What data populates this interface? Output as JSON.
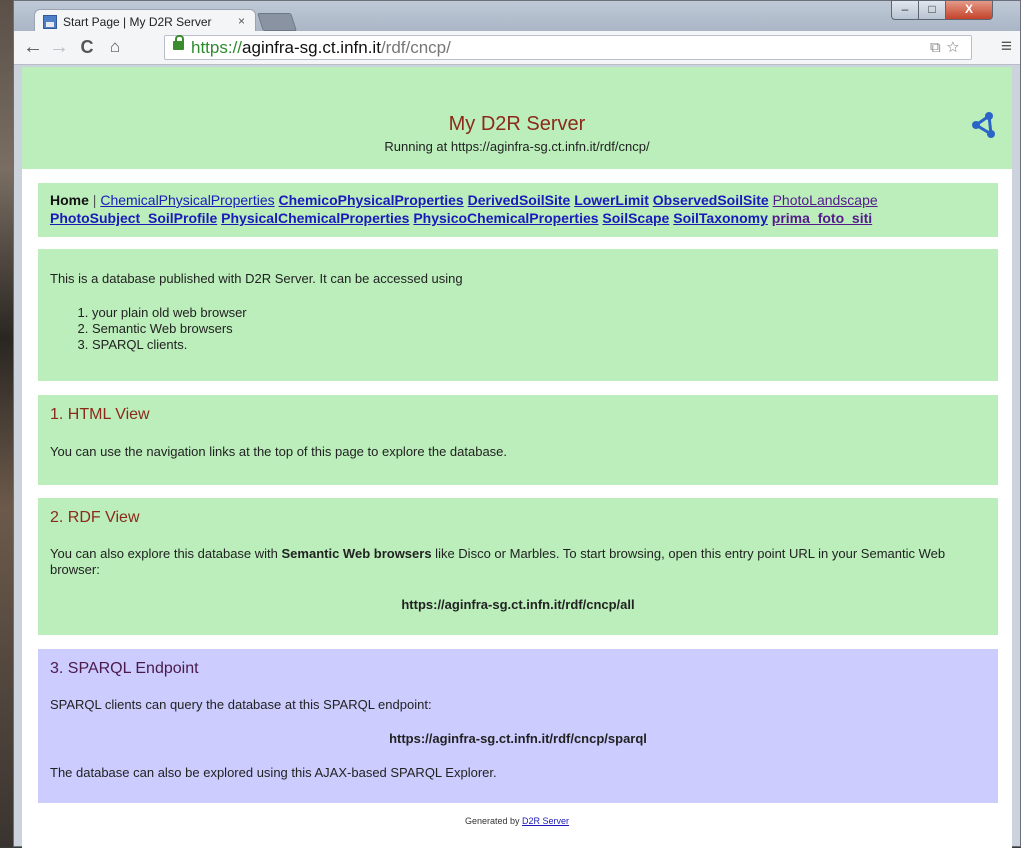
{
  "browser": {
    "tab_title": "Start Page | My D2R Server",
    "tab_close": "×",
    "url_scheme": "https://",
    "url_host": "aginfra-sg.ct.infn.it",
    "url_path": "/rdf/cncp/",
    "nav_back": "←",
    "nav_forward": "→",
    "nav_reload": "C",
    "nav_home": "⌂",
    "menu": "≡",
    "omni_icons": "⧉☆",
    "win_min": "–",
    "win_max": "□",
    "win_close": "X"
  },
  "header": {
    "title": "My D2R Server",
    "subtitle": "Running at https://aginfra-sg.ct.infn.it/rdf/cncp/",
    "share_icon": "share-icon"
  },
  "nav": {
    "home": "Home",
    "separator": "|",
    "links": [
      "ChemicalPhysicalProperties",
      "ChemicoPhysicalProperties",
      "DerivedSoilSite",
      "LowerLimit",
      "ObservedSoilSite",
      "PhotoLandscape",
      "PhotoSubject_SoilProfile",
      "PhysicalChemicalProperties",
      "PhysicoChemicalProperties",
      "SoilScape",
      "SoilTaxonomy",
      "prima_foto_siti"
    ]
  },
  "intro": {
    "text": "This is a database published with D2R Server. It can be accessed using",
    "items": [
      "your plain old web browser",
      "Semantic Web browsers",
      "SPARQL clients."
    ]
  },
  "html_view": {
    "title": "1. HTML View",
    "text": "You can use the navigation links at the top of this page to explore the database."
  },
  "rdf_view": {
    "title": "2. RDF View",
    "text_1": "You can also explore this database with ",
    "bold": "Semantic Web browsers",
    "text_2": " like ",
    "link_1": "Disco",
    "text_3": " or ",
    "link_2": "Marbles",
    "text_4": ". To start browsing, open this entry point URL in your Semantic Web browser:",
    "entry_url": "https://aginfra-sg.ct.infn.it/rdf/cncp/all"
  },
  "sparql": {
    "title": "3. SPARQL Endpoint",
    "text": "SPARQL clients can query the database at this SPARQL endpoint:",
    "endpoint": "https://aginfra-sg.ct.infn.it/rdf/cncp/sparql",
    "explorer_text": "The database can also be explored using ",
    "explorer_link": "this AJAX-based SPARQL Explorer",
    "explorer_end": "."
  },
  "footer": {
    "text": "Generated by ",
    "link": "D2R Server"
  },
  "colors": {
    "green_panel": "#bbeebb",
    "violet_panel": "#ccccff",
    "title_red": "#8b2a1a",
    "link_blue": "#1a1abb",
    "link_visited": "#551a8b"
  }
}
